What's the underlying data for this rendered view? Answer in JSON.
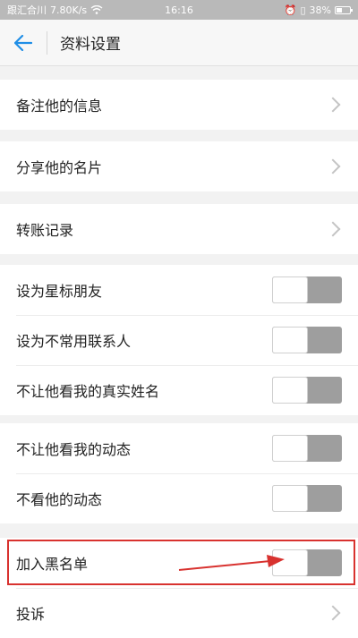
{
  "status_bar": {
    "carrier": "跟汇合川",
    "speed": "7.80K/s",
    "time": "16:16",
    "battery": "38%",
    "icons": [
      "wifi-icon",
      "alarm-icon",
      "vibrate-icon",
      "battery-icon"
    ]
  },
  "header": {
    "back_icon": "arrow-left-icon",
    "title": "资料设置"
  },
  "groups": [
    {
      "items": [
        {
          "label": "备注他的信息",
          "type": "nav"
        }
      ]
    },
    {
      "items": [
        {
          "label": "分享他的名片",
          "type": "nav"
        }
      ]
    },
    {
      "items": [
        {
          "label": "转账记录",
          "type": "nav"
        }
      ]
    },
    {
      "items": [
        {
          "label": "设为星标朋友",
          "type": "toggle",
          "on": false
        },
        {
          "label": "设为不常用联系人",
          "type": "toggle",
          "on": false
        },
        {
          "label": "不让他看我的真实姓名",
          "type": "toggle",
          "on": false
        }
      ]
    },
    {
      "items": [
        {
          "label": "不让他看我的动态",
          "type": "toggle",
          "on": false
        },
        {
          "label": "不看他的动态",
          "type": "toggle",
          "on": false
        }
      ]
    },
    {
      "items": [
        {
          "label": "加入黑名单",
          "type": "toggle",
          "on": false
        },
        {
          "label": "投诉",
          "type": "nav"
        }
      ]
    }
  ],
  "colors": {
    "accent": "#1f8ee6",
    "highlight": "#d8322f",
    "toggle_track": "#9e9e9e"
  }
}
